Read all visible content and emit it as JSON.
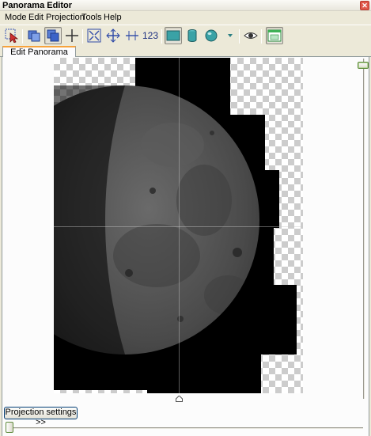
{
  "window": {
    "title": "Panorama Editor"
  },
  "menu": [
    "Mode",
    "Edit",
    "Projection",
    "Tools",
    "Help"
  ],
  "toolbar": {
    "num_transform_label": "123"
  },
  "tabs": [
    {
      "label": "Edit Panorama",
      "active": true
    }
  ],
  "buttons": {
    "projection_settings": "Projection settings >>"
  },
  "colors": {
    "tab_accent": "#f7a33c",
    "slider_accent": "#5f8b3c"
  }
}
